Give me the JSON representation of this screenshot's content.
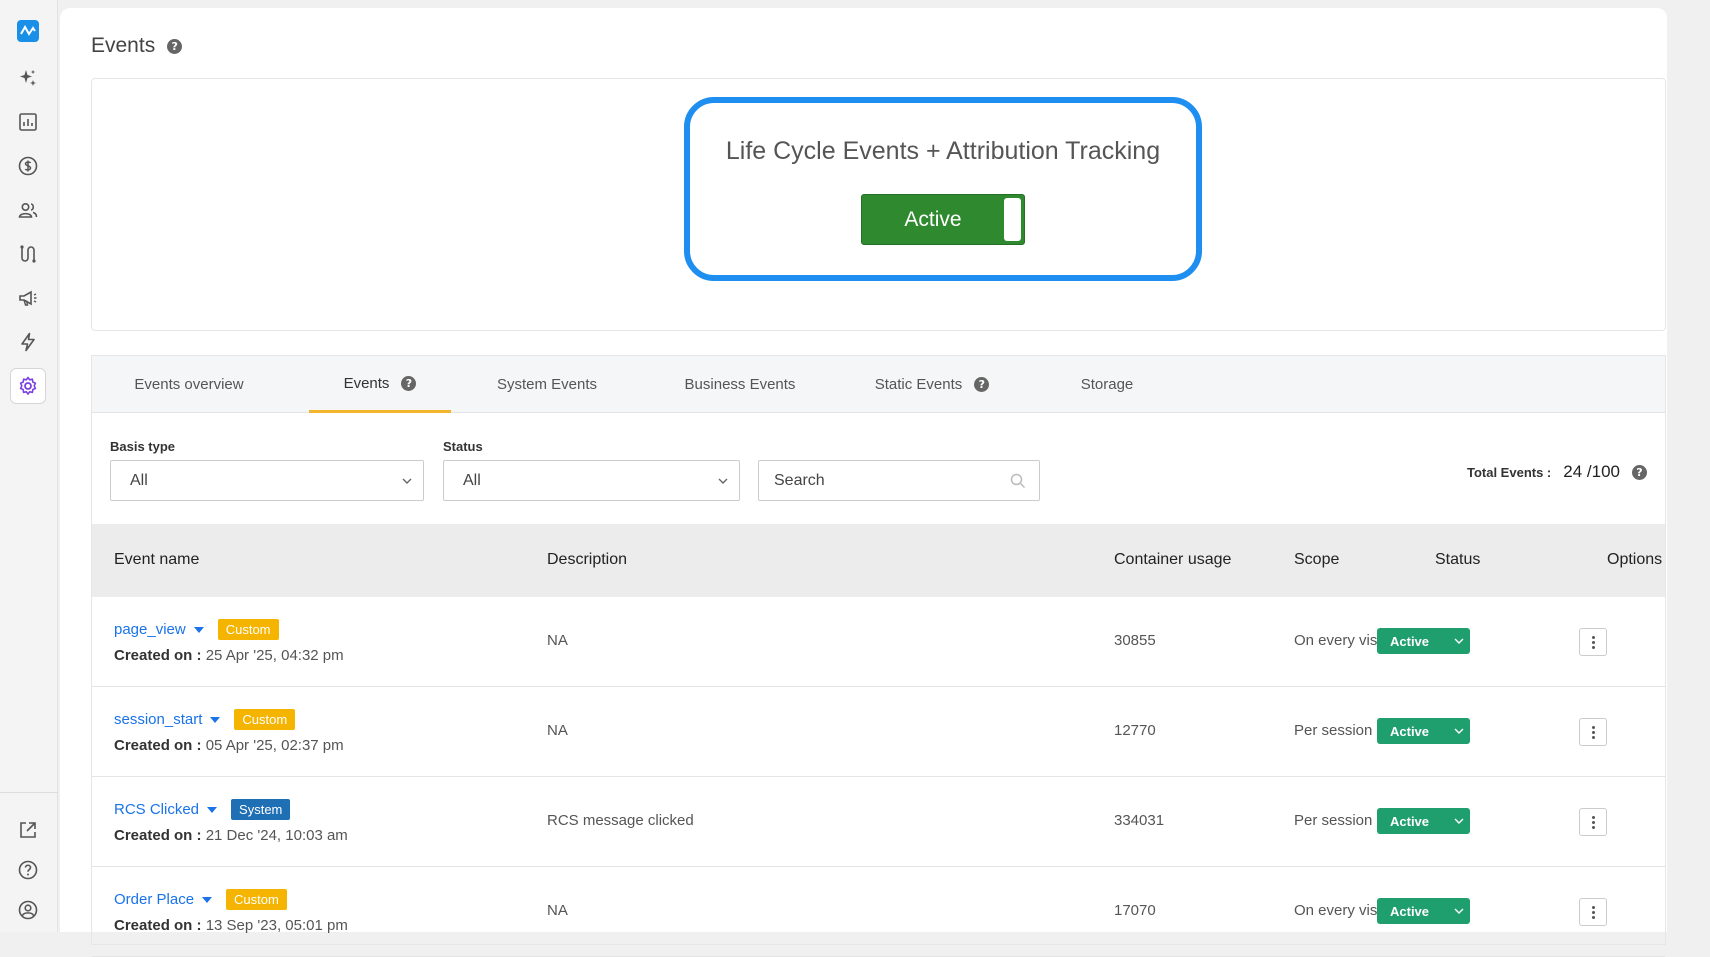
{
  "page": {
    "title": "Events"
  },
  "hero": {
    "title": "Life Cycle Events + Attribution Tracking",
    "toggle_label": "Active",
    "toggle_on": true
  },
  "tabs": [
    {
      "label": "Events overview"
    },
    {
      "label": "Events"
    },
    {
      "label": "System Events"
    },
    {
      "label": "Business Events"
    },
    {
      "label": "Static Events"
    },
    {
      "label": "Storage"
    }
  ],
  "filters": {
    "basis_type": {
      "label": "Basis type",
      "value": "All"
    },
    "status": {
      "label": "Status",
      "value": "All"
    },
    "search": {
      "placeholder": "Search"
    },
    "total_label": "Total Events :",
    "total_value": "24 /100"
  },
  "table": {
    "headers": {
      "event_name": "Event name",
      "description": "Description",
      "container_usage": "Container usage",
      "scope": "Scope",
      "status": "Status",
      "options": "Options"
    },
    "created_label": "Created on :",
    "rows": [
      {
        "name": "page_view",
        "badge": "Custom",
        "created": "25 Apr '25, 04:32 pm",
        "description": "NA",
        "usage": "30855",
        "scope": "On every visit",
        "status": "Active"
      },
      {
        "name": "session_start",
        "badge": "Custom",
        "created": "05 Apr '25, 02:37 pm",
        "description": "NA",
        "usage": "12770",
        "scope": "Per session",
        "status": "Active"
      },
      {
        "name": "RCS Clicked",
        "badge": "System",
        "created": "21 Dec '24, 10:03 am",
        "description": "RCS message clicked",
        "usage": "334031",
        "scope": "Per session",
        "status": "Active"
      },
      {
        "name": "Order Place",
        "badge": "Custom",
        "created": "13 Sep '23, 05:01 pm",
        "description": "NA",
        "usage": "17070",
        "scope": "On every visit",
        "status": "Active"
      }
    ]
  },
  "colors": {
    "accent": "#1e8ef0",
    "toggle": "#2f8a2f",
    "status": "#1f9e6e",
    "custom_badge": "#f4b400",
    "system_badge": "#1f6fb5",
    "tab_underline": "#f2b52d"
  }
}
